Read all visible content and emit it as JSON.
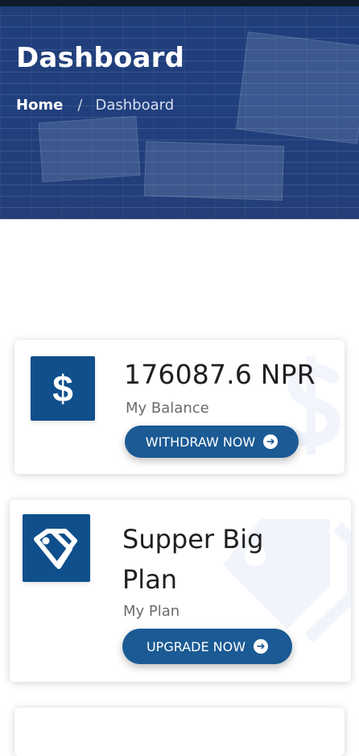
{
  "header": {
    "title": "Dashboard",
    "breadcrumb": {
      "home": "Home",
      "separator": "/",
      "current": "Dashboard"
    }
  },
  "cards": {
    "balance": {
      "value": "176087.6 NPR",
      "caption": "My Balance",
      "button_label": "WITHDRAW NOW",
      "icon": "dollar-icon"
    },
    "plan": {
      "value": "Supper Big Plan",
      "caption": "My Plan",
      "button_label": "UPGRADE NOW",
      "icon": "price-tags-icon"
    }
  },
  "colors": {
    "hero_overlay": "#1f3e7a",
    "primary": "#0f4f8c",
    "button": "#1b5a94",
    "watermark": "#c7d2f3",
    "text": "#1f1f1f",
    "muted": "#6b6b6b"
  }
}
